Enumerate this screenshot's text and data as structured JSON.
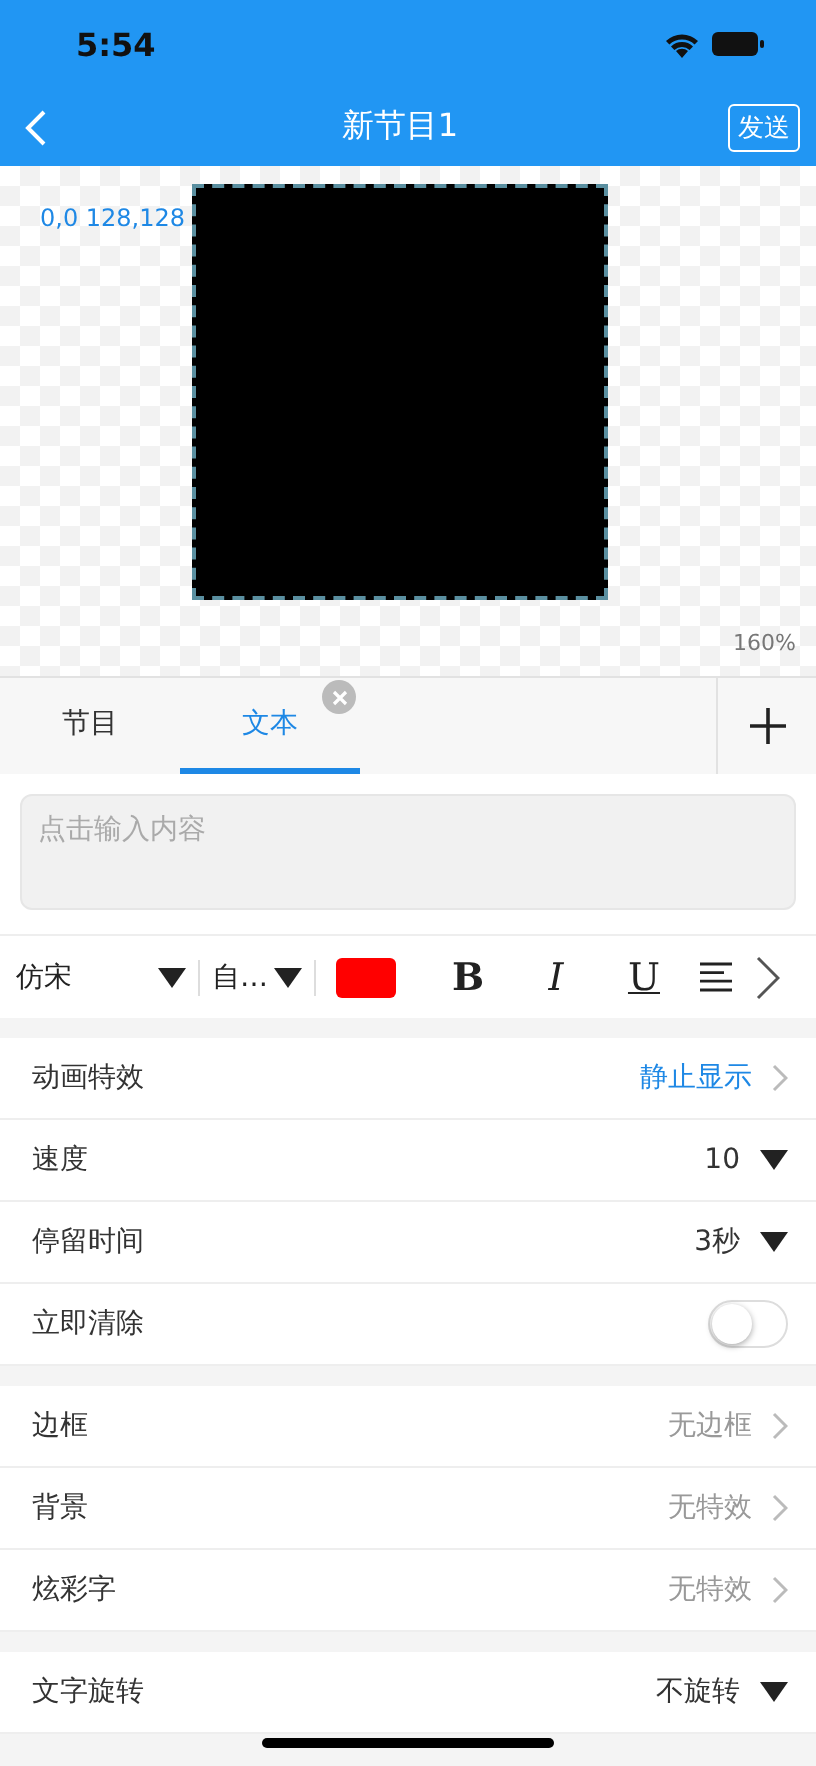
{
  "status_bar": {
    "time": "5:54"
  },
  "nav": {
    "title": "新节目1",
    "send": "发送"
  },
  "canvas": {
    "coords": "0,0 128,128",
    "zoom": "160%"
  },
  "tabs": [
    {
      "label": "节目",
      "selected": false,
      "closable": false
    },
    {
      "label": "文本",
      "selected": true,
      "closable": true
    }
  ],
  "input": {
    "placeholder": "点击输入内容"
  },
  "toolbar": {
    "font": "仿宋",
    "size": "自…",
    "color": "#ff0000",
    "bold": "B",
    "italic": "I",
    "underline": "U"
  },
  "groups": [
    [
      {
        "kind": "link",
        "label": "动画特效",
        "value": "静止显示",
        "emphasized": true
      },
      {
        "kind": "dropdown",
        "label": "速度",
        "value": "10"
      },
      {
        "kind": "dropdown",
        "label": "停留时间",
        "value": "3秒"
      },
      {
        "kind": "toggle",
        "label": "立即清除",
        "on": false
      }
    ],
    [
      {
        "kind": "link",
        "label": "边框",
        "value": "无边框",
        "emphasized": false
      },
      {
        "kind": "link",
        "label": "背景",
        "value": "无特效",
        "emphasized": false
      },
      {
        "kind": "link",
        "label": "炫彩字",
        "value": "无特效",
        "emphasized": false
      }
    ],
    [
      {
        "kind": "dropdown",
        "label": "文字旋转",
        "value": "不旋转"
      }
    ]
  ]
}
